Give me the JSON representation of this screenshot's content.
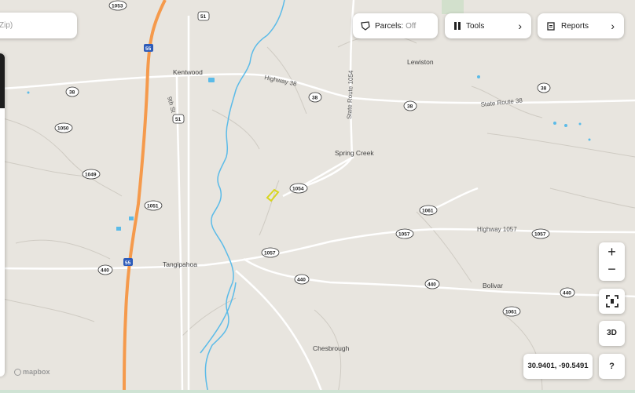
{
  "search": {
    "placeholder": "Zip)"
  },
  "toolbar": {
    "parcels_label": "Parcels:",
    "parcels_state": "Off",
    "tools_label": "Tools",
    "reports_label": "Reports"
  },
  "controls": {
    "zoom_in": "+",
    "zoom_out": "−",
    "mode_3d": "3D",
    "help": "?",
    "coordinates": "30.9401, -90.5491"
  },
  "attribution": {
    "logo": "mapbox"
  },
  "map": {
    "towns": [
      "Kentwood",
      "Lewiston",
      "Spring Creek",
      "Tangipahoa",
      "Bolivar",
      "Chesbrough"
    ],
    "roads": [
      "Highway 38",
      "State Route 38",
      "State Route 1054",
      "Highway 1057",
      "9th St"
    ],
    "shields": {
      "i55_top": "55",
      "i55_mid": "55",
      "i55_bot": "55",
      "us51_top": "51",
      "us51_mid": "51",
      "r1053": "1053",
      "r38a": "38",
      "r38b": "38",
      "r38c": "38",
      "r38d": "38",
      "r1050": "1050",
      "r1049": "1049",
      "r1051": "1051",
      "r1054": "1054",
      "r1061a": "1061",
      "r1061b": "1061",
      "r1057a": "1057",
      "r1057b": "1057",
      "r1057c": "1057",
      "r440a": "440",
      "r440b": "440",
      "r440c": "440",
      "r440d": "440"
    }
  },
  "colors": {
    "interstate": "#f59a4c",
    "water": "#5bbbe8",
    "land": "#e8e5df",
    "parcel": "#d8d51e"
  }
}
